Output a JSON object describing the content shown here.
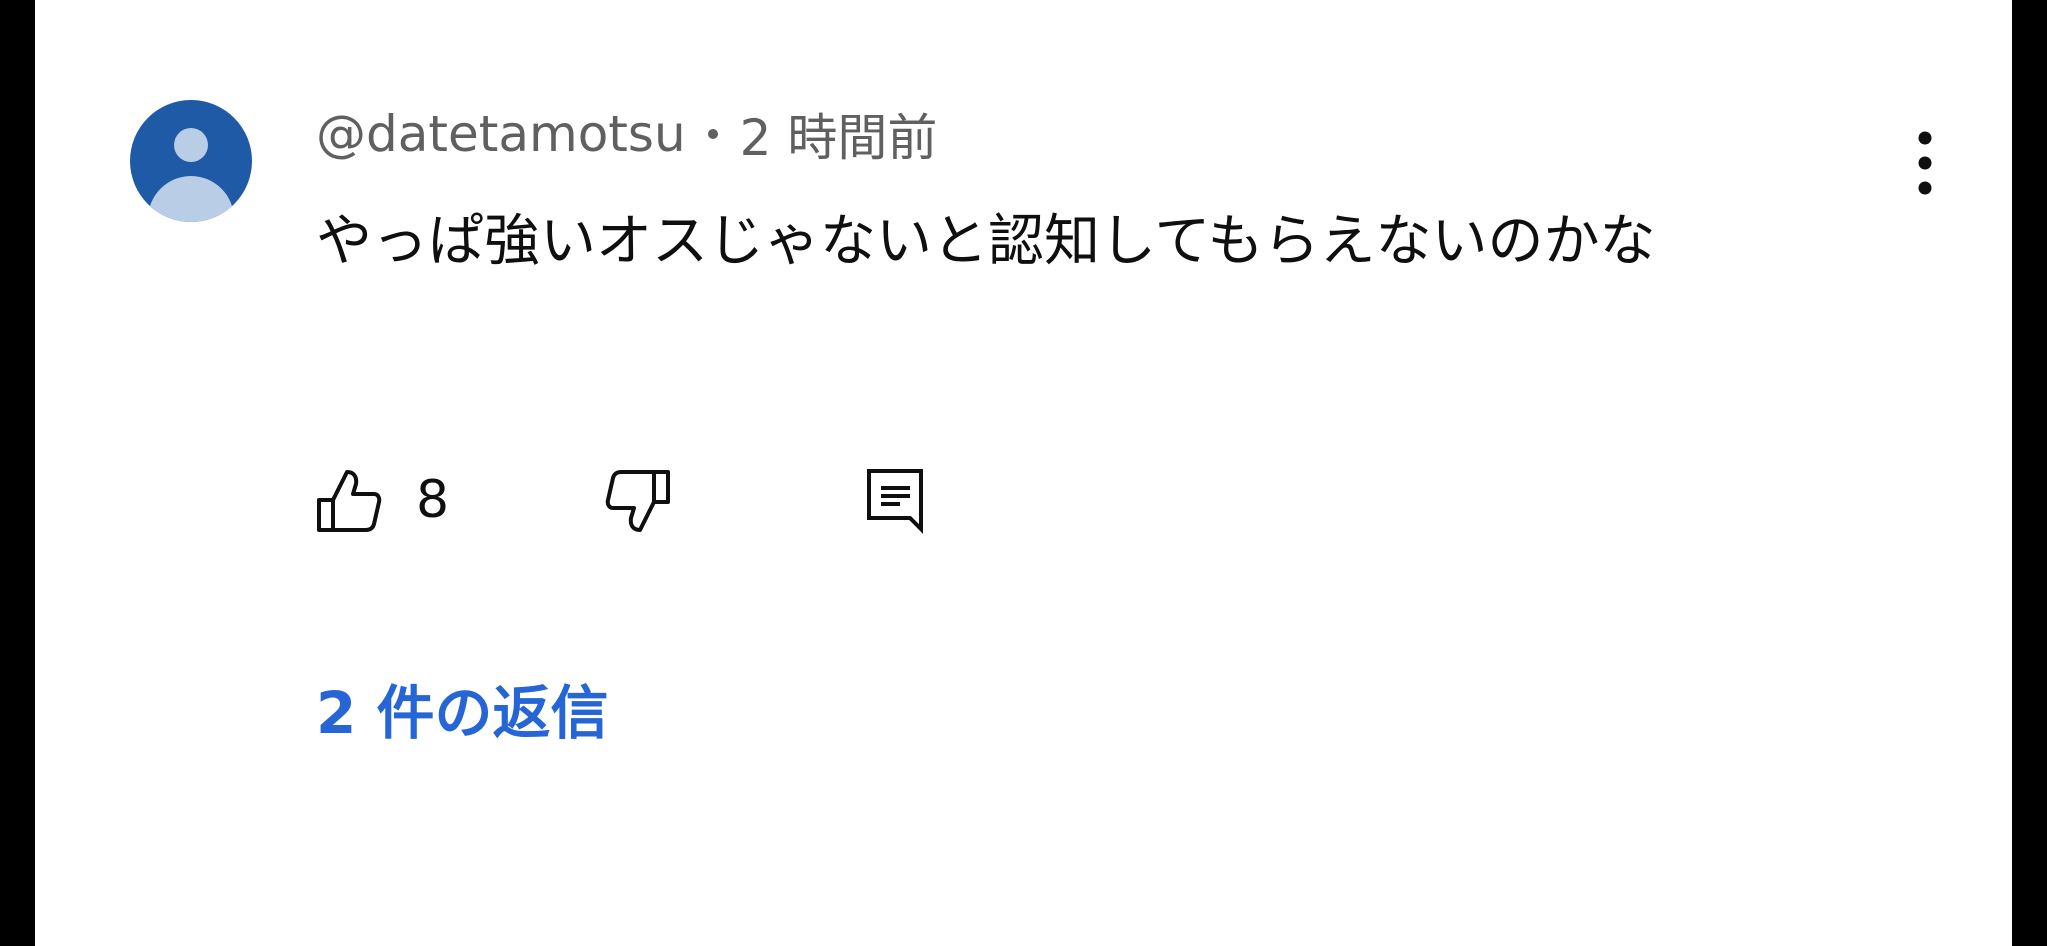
{
  "comment": {
    "username": "@datetamotsu",
    "timestamp": "2 時間前",
    "text": "やっぱ強いオスじゃないと認知してもらえないのかな",
    "like_count": "8",
    "replies_label": "2 件の返信"
  },
  "colors": {
    "avatar_bg": "#1f5aa6",
    "avatar_fg": "#b9cde6",
    "meta_text": "#606060",
    "link": "#2565d6"
  },
  "icons": {
    "avatar": "default-user-avatar",
    "like": "thumb-up-icon",
    "dislike": "thumb-down-icon",
    "reply": "comment-reply-icon",
    "more": "vertical-ellipsis-icon"
  }
}
